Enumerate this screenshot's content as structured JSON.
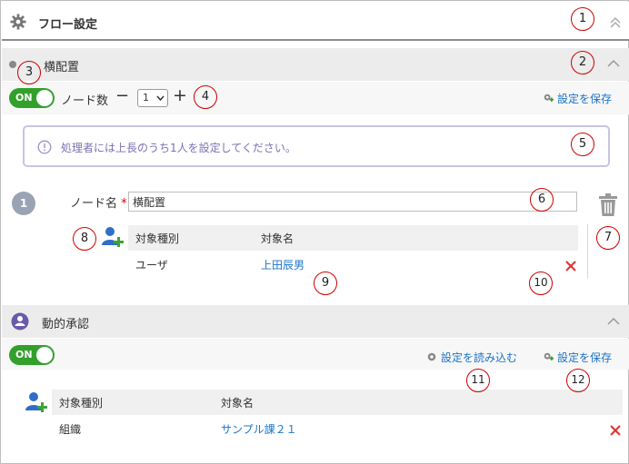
{
  "header": {
    "title": "フロー設定"
  },
  "section1": {
    "title": "横配置",
    "toggle_label": "ON",
    "node_count_label": "ノード数",
    "node_count_value": "1",
    "minus": "−",
    "plus": "+",
    "save_label": "設定を保存",
    "notice": "処理者には上長のうち1人を設定してください。",
    "step_number": "1",
    "node_name_label": "ノード名",
    "required_mark": "*",
    "node_name_value": "横配置",
    "table": {
      "headers": [
        "対象種別",
        "対象名"
      ],
      "rows": [
        {
          "type": "ユーザ",
          "name": "上田辰男"
        }
      ]
    }
  },
  "section2": {
    "title": "動的承認",
    "toggle_label": "ON",
    "load_label": "設定を読み込む",
    "save_label": "設定を保存",
    "table": {
      "headers": [
        "対象種別",
        "対象名"
      ],
      "rows": [
        {
          "type": "組織",
          "name": "サンプル課２１"
        }
      ]
    }
  },
  "callouts": [
    "1",
    "2",
    "3",
    "4",
    "5",
    "6",
    "7",
    "8",
    "9",
    "10",
    "11",
    "12"
  ],
  "colors": {
    "accent": "#1a73c8",
    "toggle_on": "#33a02c",
    "delete": "#d33333",
    "callout": "#cc0000"
  }
}
